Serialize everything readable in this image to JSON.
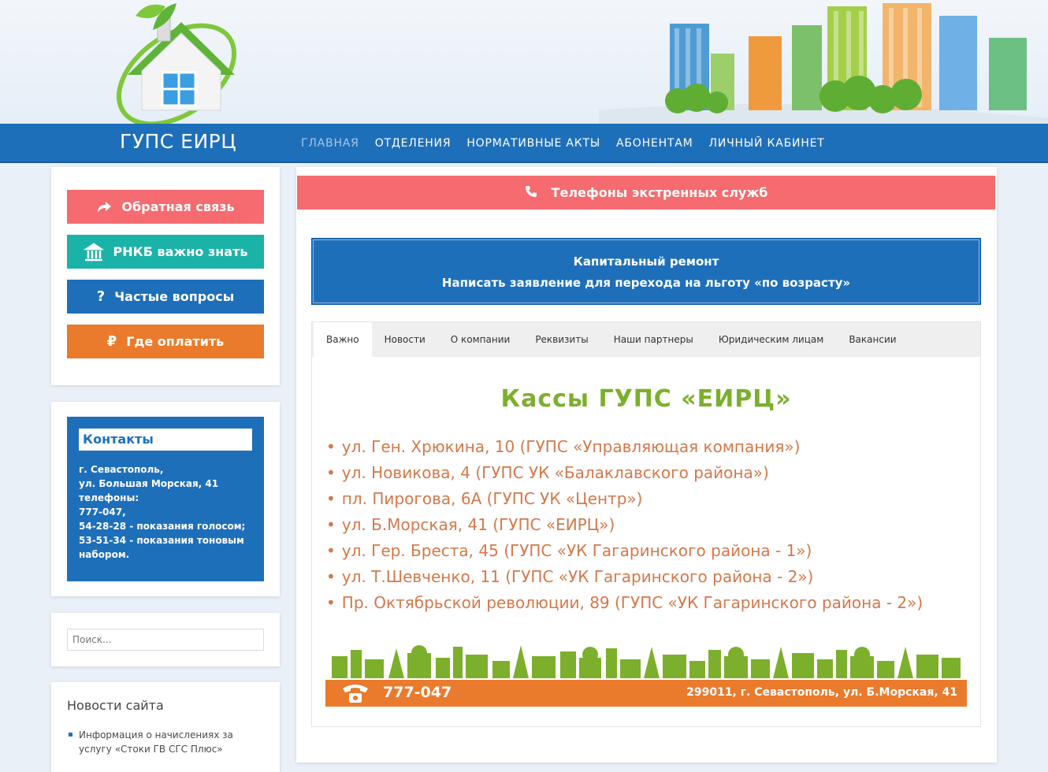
{
  "header": {
    "brand": "ГУПС ЕИРЦ",
    "nav": [
      {
        "label": "ГЛАВНАЯ",
        "active": true
      },
      {
        "label": "ОТДЕЛЕНИЯ"
      },
      {
        "label": "НОРМАТИВНЫЕ АКТЫ"
      },
      {
        "label": "АБОНЕНТАМ"
      },
      {
        "label": "ЛИЧНЫЙ КАБИНЕТ"
      }
    ]
  },
  "sidebar": {
    "buttons": [
      {
        "label": "Обратная связь",
        "icon": "share-arrow-icon",
        "color": "#f56b6f"
      },
      {
        "label": "РНКБ важно знать",
        "icon": "bank-icon",
        "color": "#1bb3a8"
      },
      {
        "label": "Частые вопросы",
        "icon": "question-icon",
        "color": "#1e6fba"
      },
      {
        "label": "Где оплатить",
        "icon": "ruble-icon",
        "color": "#ea7a2c"
      }
    ],
    "contacts": {
      "title": "Контакты",
      "lines": [
        "г. Севастополь,",
        "ул. Большая Морская, 41",
        "телефоны:",
        "777-047,",
        "54-28-28 - показания голосом;",
        "53-51-34 - показания тоновым",
        "набором."
      ]
    },
    "search": {
      "placeholder": "Поиск..."
    },
    "news": {
      "title": "Новости сайта",
      "items": [
        "Информация о начислениях за услугу «Стоки ГВ СГС Плюс»"
      ]
    }
  },
  "main": {
    "emergency": "Телефоны экстренных служб",
    "notice_lines": [
      "Капитальный ремонт",
      "Написать заявление для перехода на льготу «по возрасту»"
    ],
    "tabs": [
      "Важно",
      "Новости",
      "О компании",
      "Реквизиты",
      "Наши партнеры",
      "Юридическим лицам",
      "Вакансии"
    ],
    "kassy_title": "Кассы ГУПС «ЕИРЦ»",
    "addresses": [
      "ул. Ген. Хрюкина, 10 (ГУПС «Управляющая компания»)",
      "ул. Новикова, 4 (ГУПС УК «Балаклавского района»)",
      "пл. Пирогова, 6А (ГУПС УК «Центр»)",
      "ул. Б.Морская, 41 (ГУПС «ЕИРЦ»)",
      "ул. Гер. Бреста, 45 (ГУПС «УК Гагаринского района - 1»)",
      "ул. Т.Шевченко, 11 (ГУПС «УК Гагаринского района - 2»)",
      "Пр. Октябрьской революции, 89 (ГУПС «УК Гагаринского района - 2»)"
    ],
    "banner": {
      "phone": "777-047",
      "address": "299011, г. Севастополь, ул. Б.Морская, 41"
    }
  },
  "colors": {
    "brand_blue": "#1e6fba",
    "coral": "#f56b6f",
    "teal": "#1bb3a8",
    "orange": "#ea7a2c",
    "green": "#7caf2b"
  }
}
